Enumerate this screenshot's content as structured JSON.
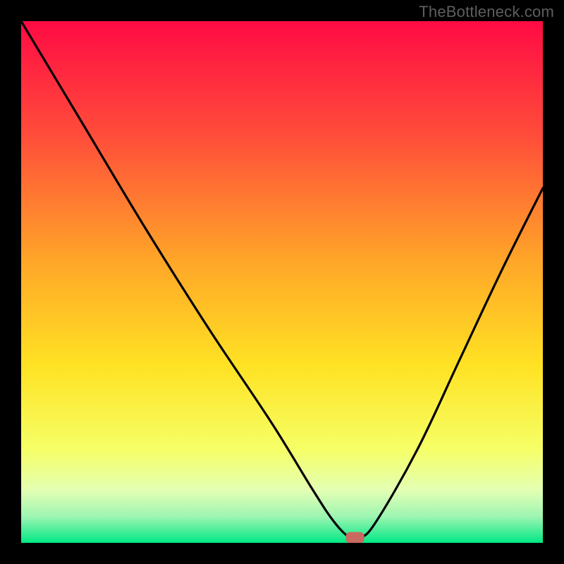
{
  "watermark": "TheBottleneck.com",
  "chart_data": {
    "type": "line",
    "title": "",
    "xlabel": "",
    "ylabel": "",
    "xlim": [
      0,
      100
    ],
    "ylim": [
      0,
      100
    ],
    "grid": false,
    "legend": false,
    "series": [
      {
        "name": "bottleneck-curve",
        "x": [
          0,
          12,
          24,
          36,
          48,
          56,
          60,
          63,
          65,
          68,
          76,
          84,
          92,
          100
        ],
        "values": [
          100,
          80,
          60,
          41,
          23,
          10,
          4,
          1,
          1,
          4,
          18,
          35,
          52,
          68
        ]
      }
    ],
    "marker": {
      "name": "optimal-point",
      "x": 64,
      "y": 1,
      "color": "#c86a60"
    },
    "background_gradient": {
      "top": "#ff0b44",
      "mid_upper": "#ff8a32",
      "mid": "#ffe524",
      "mid_lower": "#f3ff8f",
      "bottom": "#00e884"
    }
  }
}
